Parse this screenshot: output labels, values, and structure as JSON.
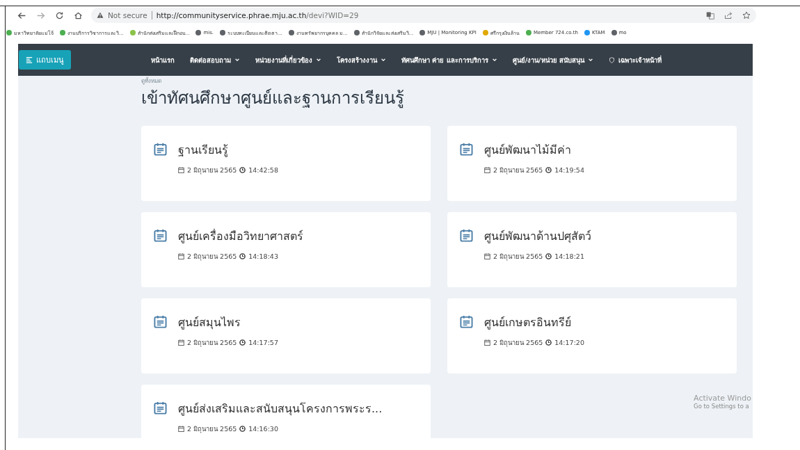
{
  "browser": {
    "security": "Not secure",
    "url_host": "http://communityservice.phrae.mju.ac.th",
    "url_path": "/devi?WID=29"
  },
  "bookmarks": [
    {
      "label": "มหาวิทยาลัยแม่โจ้",
      "color": "#4caf50"
    },
    {
      "label": "งานบริการวิชาการและวิ...",
      "color": "#4caf50"
    },
    {
      "label": "สำนักส่งเสริมและฝึกอบ...",
      "color": "#8bc34a"
    },
    {
      "label": "mis.",
      "color": "#5f6368"
    },
    {
      "label": "ระบบทะเบียนและติดตา...",
      "color": "#5f6368"
    },
    {
      "label": "งานทรัพยากรบุคคล ม...",
      "color": "#5f6368"
    },
    {
      "label": "สำนักวิจัยและส่งเสริมวิ...",
      "color": "#5f6368"
    },
    {
      "label": "MJU | Monitoring KPI",
      "color": "#5f6368"
    },
    {
      "label": "ศรีกรุงเงินล้าน",
      "color": "#e0a800"
    },
    {
      "label": "Member 724.co.th",
      "color": "#4caf50"
    },
    {
      "label": "KTAM",
      "color": "#2196f3"
    },
    {
      "label": "mo",
      "color": "#5f6368"
    }
  ],
  "navbar": {
    "menu_button": "แถบเมนู",
    "items": [
      {
        "label": "หน้าแรก",
        "kind": "link"
      },
      {
        "label": "ติดต่อสอบถาม",
        "kind": "dropdown"
      },
      {
        "label": "หน่วยงานที่เกี่ยวข้อง",
        "kind": "dropdown"
      },
      {
        "label": "โครงสร้างงาน",
        "kind": "dropdown"
      },
      {
        "label": "ทัศนศึกษา ค่าย และการบริการ",
        "kind": "dropdown"
      },
      {
        "label": "ศูนย์/งาน/หน่วย สนับสนุน",
        "kind": "dropdown"
      },
      {
        "label": "เฉพาะเจ้าหน้าที่",
        "kind": "staff"
      }
    ]
  },
  "section": {
    "view_all": "ดูทั้งหมด",
    "title": "เข้าทัศนศึกษาศูนย์และฐานการเรียนรู้"
  },
  "cards": [
    {
      "title": "ฐานเรียนรู้",
      "date": "2 มิถุนายน 2565",
      "time": "14:42:58"
    },
    {
      "title": "ศูนย์พัฒนาไม้มีค่า",
      "date": "2 มิถุนายน 2565",
      "time": "14:19:54"
    },
    {
      "title": "ศูนย์เครื่องมือวิทยาศาสตร์",
      "date": "2 มิถุนายน 2565",
      "time": "14:18:43"
    },
    {
      "title": "ศูนย์พัฒนาด้านปศุสัตว์",
      "date": "2 มิถุนายน 2565",
      "time": "14:18:21"
    },
    {
      "title": "ศูนย์สมุนไพร",
      "date": "2 มิถุนายน 2565",
      "time": "14:17:57"
    },
    {
      "title": "ศูนย์เกษตรอินทรีย์",
      "date": "2 มิถุนายน 2565",
      "time": "14:17:20"
    },
    {
      "title": "ศูนย์ส่งเสริมและสนับสนุนโครงการพระร...",
      "date": "2 มิถุนายน 2565",
      "time": "14:16:30"
    }
  ],
  "os_notice": {
    "title": "Activate Windo",
    "subtitle": "Go to Settings to a"
  }
}
